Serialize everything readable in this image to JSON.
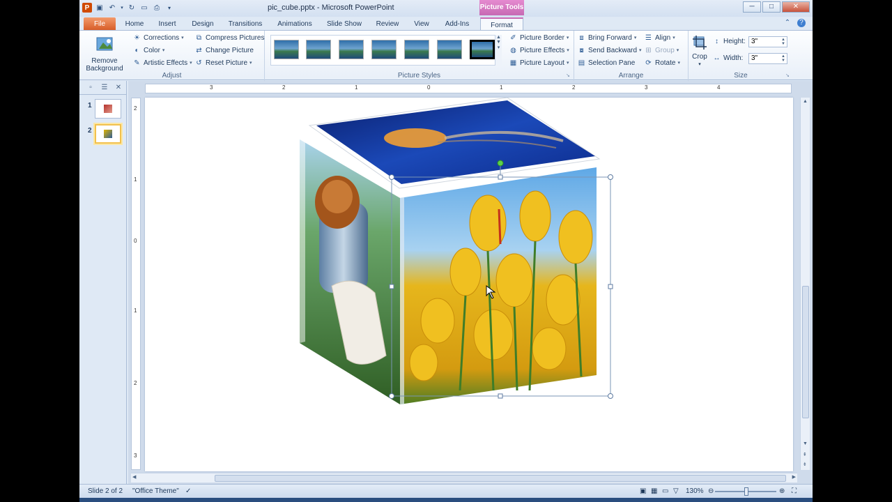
{
  "window": {
    "title": "pic_cube.pptx - Microsoft PowerPoint",
    "context_tab_title": "Picture Tools",
    "controls": {
      "minimize": "─",
      "maximize": "□",
      "close": "✕"
    }
  },
  "qat": {
    "logo": "P"
  },
  "tabs": [
    {
      "label": "File"
    },
    {
      "label": "Home"
    },
    {
      "label": "Insert"
    },
    {
      "label": "Design"
    },
    {
      "label": "Transitions"
    },
    {
      "label": "Animations"
    },
    {
      "label": "Slide Show"
    },
    {
      "label": "Review"
    },
    {
      "label": "View"
    },
    {
      "label": "Add-Ins"
    },
    {
      "label": "Format"
    }
  ],
  "ribbon": {
    "adjust": {
      "label": "Adjust",
      "remove_background": "Remove Background",
      "corrections": "Corrections",
      "color": "Color",
      "artistic_effects": "Artistic Effects",
      "compress_pictures": "Compress Pictures",
      "change_picture": "Change Picture",
      "reset_picture": "Reset Picture"
    },
    "picture_styles": {
      "label": "Picture Styles",
      "picture_border": "Picture Border",
      "picture_effects": "Picture Effects",
      "picture_layout": "Picture Layout"
    },
    "arrange": {
      "label": "Arrange",
      "bring_forward": "Bring Forward",
      "send_backward": "Send Backward",
      "selection_pane": "Selection Pane",
      "align": "Align",
      "group": "Group",
      "rotate": "Rotate"
    },
    "size": {
      "label": "Size",
      "crop": "Crop",
      "height_label": "Height:",
      "height_value": "3\"",
      "width_label": "Width:",
      "width_value": "3\""
    }
  },
  "slides": [
    {
      "number": "1"
    },
    {
      "number": "2"
    }
  ],
  "ruler": {
    "h_ticks": [
      "3",
      "2",
      "1",
      "0",
      "1",
      "2",
      "3",
      "4"
    ],
    "v_ticks": [
      "2",
      "1",
      "0",
      "1",
      "2",
      "3"
    ]
  },
  "status": {
    "slide_info": "Slide 2 of 2",
    "theme": "\"Office Theme\"",
    "zoom": "130%"
  }
}
